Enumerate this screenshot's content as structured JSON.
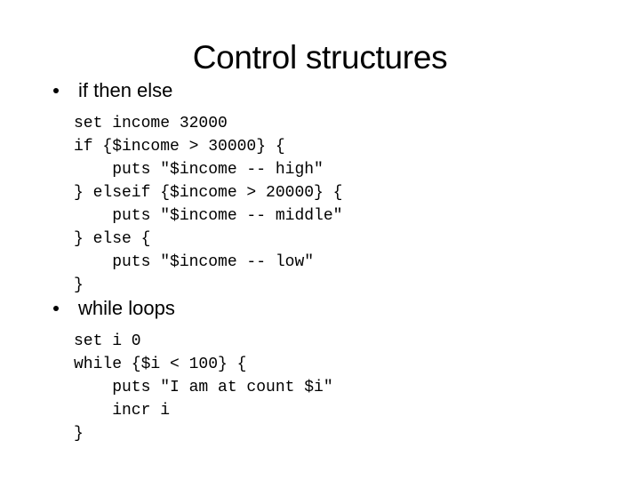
{
  "slide": {
    "title": "Control structures",
    "background_color": "#ffffff",
    "text_color": "#000000",
    "sections": [
      {
        "bullet_marker": "bullet-dot",
        "heading": "if then else",
        "code_lines": [
          "set income 32000",
          "if {$income > 30000} {",
          "    puts \"$income -- high\"",
          "} elseif {$income > 20000} {",
          "    puts \"$income -- middle\"",
          "} else {",
          "    puts \"$income -- low\"",
          "}"
        ]
      },
      {
        "bullet_marker": "bullet-dot",
        "heading": "while loops",
        "code_lines": [
          "set i 0",
          "while {$i < 100} {",
          "    puts \"I am at count $i\"",
          "    incr i",
          "}"
        ]
      }
    ]
  }
}
